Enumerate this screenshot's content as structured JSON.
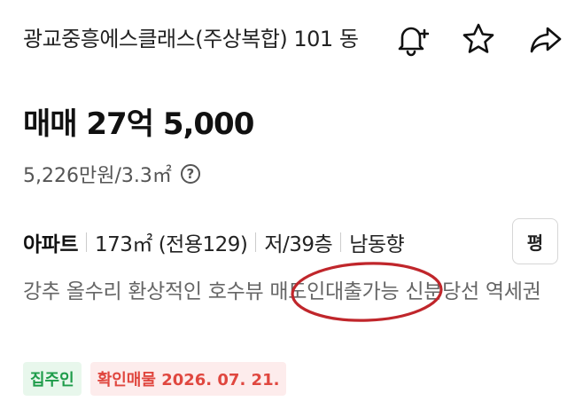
{
  "listing": {
    "complex_name": "광교중흥에스클래스(주상복합) 101 동",
    "price": "매매 27억 5,000",
    "unit_price": "5,226만원/3.3㎡",
    "specs": {
      "type": "아파트",
      "area": "173㎡ (전용129)",
      "floor": "저/39층",
      "direction": "남동향"
    },
    "area_unit_button": "평",
    "description": "강추 올수리 환상적인 호수뷰 매도인대출가능 신분당선 역세권",
    "tags": {
      "owner": "집주인",
      "verified": "확인매물 2026. 07. 21."
    }
  },
  "icons": {
    "alert": "bell-plus-icon",
    "favorite": "star-icon",
    "share": "share-arrow-icon",
    "help": "question-circle-icon"
  },
  "colors": {
    "tag_green": "#1e9c4a",
    "tag_red": "#e0473f",
    "annotation_ring": "#c0262b"
  }
}
